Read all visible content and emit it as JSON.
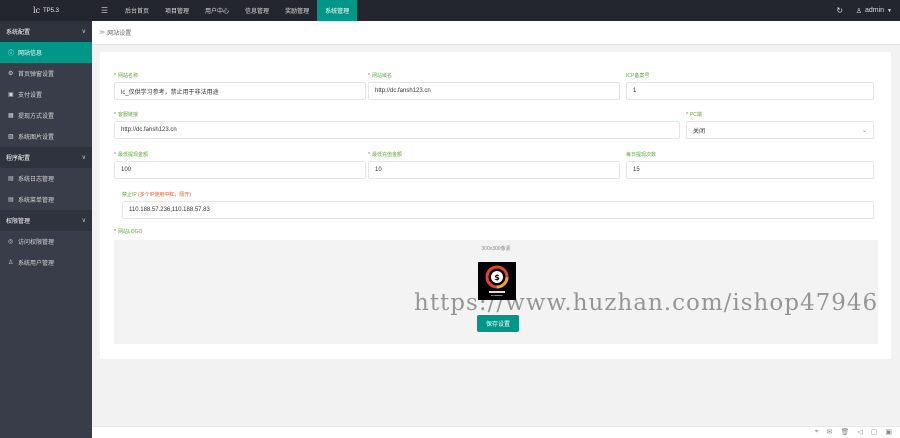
{
  "app": {
    "logo_mark": "lc",
    "logo_text": "TP5.3"
  },
  "topbar": {
    "menu_toggle": "☰",
    "nav": [
      "后台首页",
      "项目管理",
      "用户中心",
      "信息管理",
      "奖励管理",
      "系统管理"
    ],
    "active_index": 5,
    "refresh": "↻",
    "user_icon": "♙",
    "username": "admin",
    "caret": "▼"
  },
  "sidebar": {
    "groups": [
      {
        "label": "系统配置",
        "items": [
          {
            "icon": "ⓘ",
            "label": "网站信息",
            "active": true
          },
          {
            "icon": "⚙",
            "label": "首页弹窗设置"
          },
          {
            "icon": "▣",
            "label": "支付设置"
          },
          {
            "icon": "▦",
            "label": "提现方式设置"
          },
          {
            "icon": "▨",
            "label": "系统图片设置"
          }
        ]
      },
      {
        "label": "程序配置",
        "items": [
          {
            "icon": "▤",
            "label": "系统日志管理"
          },
          {
            "icon": "▤",
            "label": "系统菜单管理"
          }
        ]
      },
      {
        "label": "权限管理",
        "items": [
          {
            "icon": "◎",
            "label": "访问权限管理"
          },
          {
            "icon": "♙",
            "label": "系统用户管理"
          }
        ]
      }
    ],
    "chevron": "∨"
  },
  "breadcrumb": {
    "sep": "≫",
    "label": "网站设置"
  },
  "form": {
    "site_name": {
      "label": "网站名称",
      "value": "lc_仅供学习参考，禁止用于非法用途"
    },
    "site_domain": {
      "label": "网站域名",
      "value": "http://dc.fansh123.cn"
    },
    "icp": {
      "label": "ICP备案号",
      "value": "1"
    },
    "download_link": {
      "label": "客服链接",
      "value": "http://dc.fansh123.cn"
    },
    "pc_end": {
      "label": "PC端",
      "value": "关闭"
    },
    "min_withdraw": {
      "label": "最低提现金额",
      "value": "100"
    },
    "min_recharge": {
      "label": "最低充值金额",
      "value": "10"
    },
    "daily_withdraw": {
      "label": "每日提现次数",
      "value": "15"
    },
    "ban_ip": {
      "label": "禁止IP",
      "hint": "(多个IP使用中杠，隔开)",
      "value": "110.188.57.236,110.188.57.83"
    },
    "logo": {
      "label": "网站LOGO",
      "size_hint": "300x300像素"
    },
    "save_label": "保存设置"
  },
  "watermark": "https://www.huzhan.com/ishop47946",
  "footer": {
    "icons": [
      "⌖",
      "✉",
      "🗑",
      "◁",
      "▢",
      "▣"
    ]
  }
}
